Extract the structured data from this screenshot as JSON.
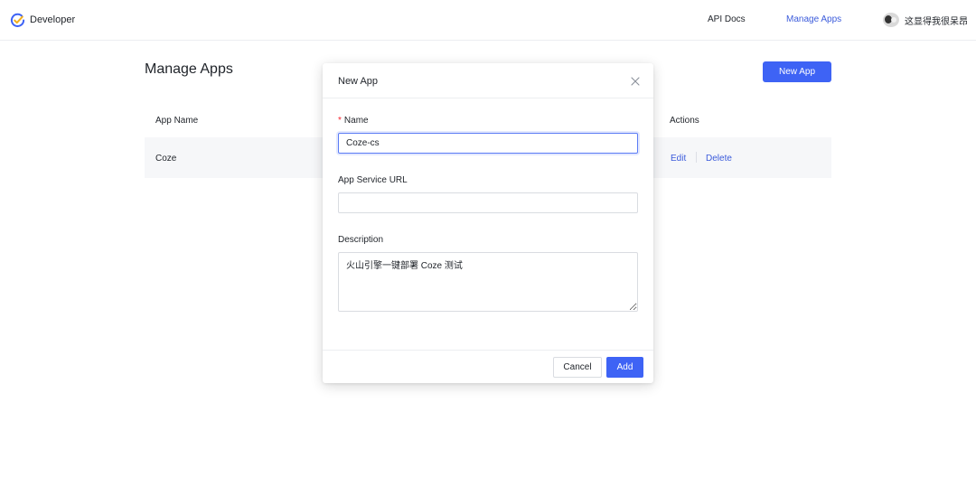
{
  "header": {
    "brand_label": "Developer",
    "brand_icon": "check-circle-icon",
    "nav": [
      {
        "label": "API Docs",
        "active": false
      },
      {
        "label": "Manage Apps",
        "active": true
      }
    ],
    "user_name": "这显得我很呆昂"
  },
  "page": {
    "title": "Manage Apps",
    "new_app_label": "New App",
    "table": {
      "columns": [
        "App Name",
        "Actions"
      ],
      "rows": [
        {
          "name": "Coze",
          "actions": [
            "Edit",
            "Delete"
          ]
        }
      ]
    }
  },
  "modal": {
    "title": "New App",
    "close_icon": "close-icon",
    "name_required_mark": "*",
    "name_label": "Name",
    "name_value": "Coze-cs",
    "url_label": "App Service URL",
    "url_value": "",
    "description_label": "Description",
    "description_value": "火山引擎一键部署 Coze 测试",
    "cancel_label": "Cancel",
    "add_label": "Add"
  },
  "colors": {
    "accent": "#3e63f5",
    "link": "#3b5bdb",
    "required": "#f5222d",
    "row_background": "#f6f7f9"
  }
}
